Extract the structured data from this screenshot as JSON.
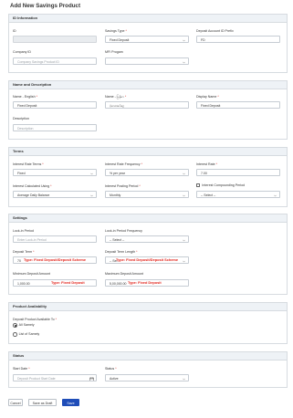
{
  "page": {
    "title": "Add New Savings Product"
  },
  "sections": {
    "id_info": {
      "title": "ID Information",
      "id_label": "ID",
      "savings_type_label": "Savings Type",
      "savings_type_value": "Fixed Deposit",
      "prefix_label": "Deposit Account ID Prefix",
      "prefix_value": "FD",
      "company_id_label": "Company ID",
      "company_id_placeholder": "Company Savings Product ID",
      "mfi_program_label": "MFI Progam",
      "mfi_program_value": ""
    },
    "name_desc": {
      "title": "Name and Description",
      "name_en_label": "Name - English",
      "name_en_value": "Fixed Deposit",
      "name_mm_label": "Name - မြန်မာ",
      "name_mm_value": "ပုံသေအပ်ငွေ",
      "display_name_label": "Display Name",
      "display_name_value": "Fixed Deposit",
      "description_label": "Description",
      "description_placeholder": "Description"
    },
    "terms": {
      "title": "Terms",
      "irt_label": "Interest Rate Terms",
      "irt_value": "Fixed",
      "irf_label": "Interest Rate Frequency",
      "irf_value": "% per year",
      "rate_label": "Interest Rate",
      "rate_value": "7.00",
      "calc_label": "Interest Calculated Using",
      "calc_value": "Average Daily Balance",
      "posting_label": "Interest Posting Period",
      "posting_value": "Monthly",
      "compounding_label": "Interest Compounding Period",
      "compounding_value": "-- Select --"
    },
    "settings": {
      "title": "Settings",
      "lockin_label": "Lock-in Period",
      "lockin_placeholder": "Enter Lock-in Period",
      "lockin_freq_label": "Lock-in Period Frequency",
      "lockin_freq_value": "-- Select --",
      "term_label": "Deposit Term",
      "term_value": "70",
      "term_annot": "Type: Fixed Deposit/Deposit Scheme",
      "term_len_label": "Deposit Term Length",
      "term_len_value": "-- Sel",
      "term_len_annot": "Type: Fixed Deposit/Deposit Scheme",
      "min_label": "Minimum Deposit Amount",
      "min_value": "1,000.00",
      "min_annot": "Type: Fixed Deposit",
      "max_label": "Maximum Deposit Amount",
      "max_value": "5,00,000.00",
      "max_annot": "Type: Fixed Deposit"
    },
    "availability": {
      "title": "Product Availability",
      "question": "Deposit Product Available To",
      "options": [
        "All Sameiy",
        "List of Sameiy"
      ]
    },
    "status": {
      "title": "Status",
      "start_label": "Start Date",
      "start_placeholder": "Deposit Product Start Date",
      "status_label": "Status",
      "status_value": "Active"
    }
  },
  "actions": {
    "cancel": "Cancel",
    "draft": "Save as Draft",
    "save": "Save"
  },
  "colors": {
    "primary": "#1f4db8",
    "annotation": "#e2231a",
    "section_header": "#eef2f6"
  }
}
